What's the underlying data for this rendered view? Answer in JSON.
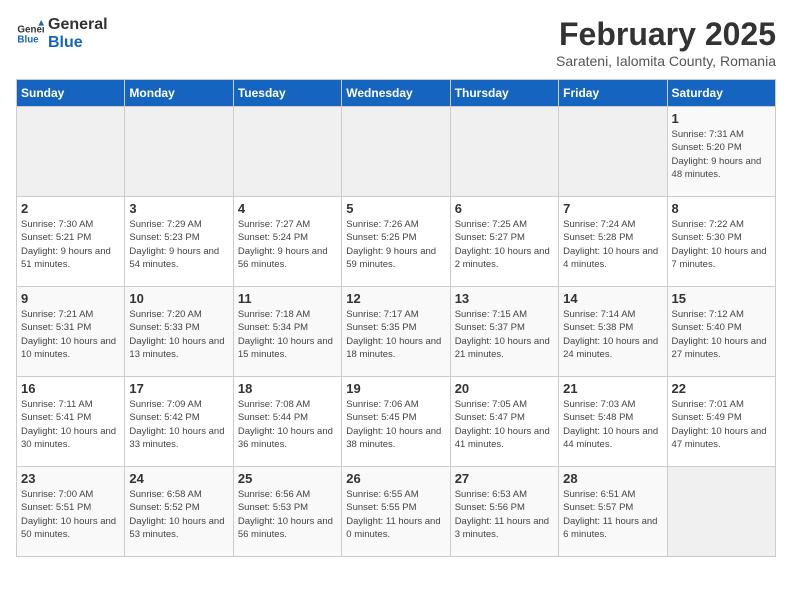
{
  "header": {
    "logo_general": "General",
    "logo_blue": "Blue",
    "month_year": "February 2025",
    "location": "Sarateni, Ialomita County, Romania"
  },
  "weekdays": [
    "Sunday",
    "Monday",
    "Tuesday",
    "Wednesday",
    "Thursday",
    "Friday",
    "Saturday"
  ],
  "weeks": [
    [
      {
        "day": "",
        "info": ""
      },
      {
        "day": "",
        "info": ""
      },
      {
        "day": "",
        "info": ""
      },
      {
        "day": "",
        "info": ""
      },
      {
        "day": "",
        "info": ""
      },
      {
        "day": "",
        "info": ""
      },
      {
        "day": "1",
        "info": "Sunrise: 7:31 AM\nSunset: 5:20 PM\nDaylight: 9 hours and 48 minutes."
      }
    ],
    [
      {
        "day": "2",
        "info": "Sunrise: 7:30 AM\nSunset: 5:21 PM\nDaylight: 9 hours and 51 minutes."
      },
      {
        "day": "3",
        "info": "Sunrise: 7:29 AM\nSunset: 5:23 PM\nDaylight: 9 hours and 54 minutes."
      },
      {
        "day": "4",
        "info": "Sunrise: 7:27 AM\nSunset: 5:24 PM\nDaylight: 9 hours and 56 minutes."
      },
      {
        "day": "5",
        "info": "Sunrise: 7:26 AM\nSunset: 5:25 PM\nDaylight: 9 hours and 59 minutes."
      },
      {
        "day": "6",
        "info": "Sunrise: 7:25 AM\nSunset: 5:27 PM\nDaylight: 10 hours and 2 minutes."
      },
      {
        "day": "7",
        "info": "Sunrise: 7:24 AM\nSunset: 5:28 PM\nDaylight: 10 hours and 4 minutes."
      },
      {
        "day": "8",
        "info": "Sunrise: 7:22 AM\nSunset: 5:30 PM\nDaylight: 10 hours and 7 minutes."
      }
    ],
    [
      {
        "day": "9",
        "info": "Sunrise: 7:21 AM\nSunset: 5:31 PM\nDaylight: 10 hours and 10 minutes."
      },
      {
        "day": "10",
        "info": "Sunrise: 7:20 AM\nSunset: 5:33 PM\nDaylight: 10 hours and 13 minutes."
      },
      {
        "day": "11",
        "info": "Sunrise: 7:18 AM\nSunset: 5:34 PM\nDaylight: 10 hours and 15 minutes."
      },
      {
        "day": "12",
        "info": "Sunrise: 7:17 AM\nSunset: 5:35 PM\nDaylight: 10 hours and 18 minutes."
      },
      {
        "day": "13",
        "info": "Sunrise: 7:15 AM\nSunset: 5:37 PM\nDaylight: 10 hours and 21 minutes."
      },
      {
        "day": "14",
        "info": "Sunrise: 7:14 AM\nSunset: 5:38 PM\nDaylight: 10 hours and 24 minutes."
      },
      {
        "day": "15",
        "info": "Sunrise: 7:12 AM\nSunset: 5:40 PM\nDaylight: 10 hours and 27 minutes."
      }
    ],
    [
      {
        "day": "16",
        "info": "Sunrise: 7:11 AM\nSunset: 5:41 PM\nDaylight: 10 hours and 30 minutes."
      },
      {
        "day": "17",
        "info": "Sunrise: 7:09 AM\nSunset: 5:42 PM\nDaylight: 10 hours and 33 minutes."
      },
      {
        "day": "18",
        "info": "Sunrise: 7:08 AM\nSunset: 5:44 PM\nDaylight: 10 hours and 36 minutes."
      },
      {
        "day": "19",
        "info": "Sunrise: 7:06 AM\nSunset: 5:45 PM\nDaylight: 10 hours and 38 minutes."
      },
      {
        "day": "20",
        "info": "Sunrise: 7:05 AM\nSunset: 5:47 PM\nDaylight: 10 hours and 41 minutes."
      },
      {
        "day": "21",
        "info": "Sunrise: 7:03 AM\nSunset: 5:48 PM\nDaylight: 10 hours and 44 minutes."
      },
      {
        "day": "22",
        "info": "Sunrise: 7:01 AM\nSunset: 5:49 PM\nDaylight: 10 hours and 47 minutes."
      }
    ],
    [
      {
        "day": "23",
        "info": "Sunrise: 7:00 AM\nSunset: 5:51 PM\nDaylight: 10 hours and 50 minutes."
      },
      {
        "day": "24",
        "info": "Sunrise: 6:58 AM\nSunset: 5:52 PM\nDaylight: 10 hours and 53 minutes."
      },
      {
        "day": "25",
        "info": "Sunrise: 6:56 AM\nSunset: 5:53 PM\nDaylight: 10 hours and 56 minutes."
      },
      {
        "day": "26",
        "info": "Sunrise: 6:55 AM\nSunset: 5:55 PM\nDaylight: 11 hours and 0 minutes."
      },
      {
        "day": "27",
        "info": "Sunrise: 6:53 AM\nSunset: 5:56 PM\nDaylight: 11 hours and 3 minutes."
      },
      {
        "day": "28",
        "info": "Sunrise: 6:51 AM\nSunset: 5:57 PM\nDaylight: 11 hours and 6 minutes."
      },
      {
        "day": "",
        "info": ""
      }
    ]
  ]
}
